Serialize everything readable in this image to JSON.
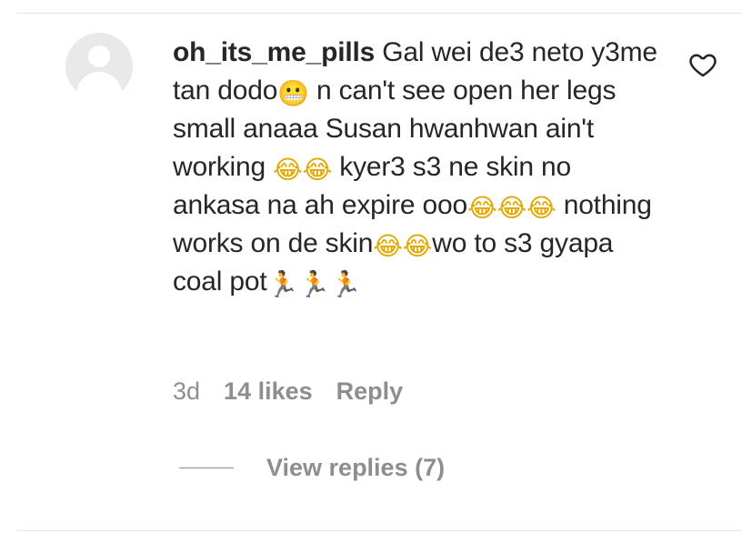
{
  "comment": {
    "username": "oh_its_me_pills",
    "segments": [
      {
        "type": "text",
        "value": "Gal wei de3 neto y3me tan dodo"
      },
      {
        "type": "emoji",
        "icon": "grimacing-face-icon",
        "glyph": "😬"
      },
      {
        "type": "text",
        "value": " n can't see open her legs small anaaa Susan hwanhwan ain't working "
      },
      {
        "type": "emoji",
        "icon": "laughing-tears-icon",
        "glyph": "😂"
      },
      {
        "type": "emoji",
        "icon": "laughing-tears-icon",
        "glyph": "😂"
      },
      {
        "type": "text",
        "value": " kyer3 s3 ne skin no ankasa na ah expire ooo"
      },
      {
        "type": "emoji",
        "icon": "laughing-tears-icon",
        "glyph": "😂"
      },
      {
        "type": "emoji",
        "icon": "laughing-tears-icon",
        "glyph": "😂"
      },
      {
        "type": "emoji",
        "icon": "laughing-tears-icon",
        "glyph": "😂"
      },
      {
        "type": "text",
        "value": " nothing works on de skin"
      },
      {
        "type": "emoji",
        "icon": "laughing-tears-icon",
        "glyph": "😂"
      },
      {
        "type": "emoji",
        "icon": "laughing-tears-icon",
        "glyph": "😂"
      },
      {
        "type": "text",
        "value": "wo to s3 gyapa coal pot"
      },
      {
        "type": "emoji",
        "icon": "running-man-icon",
        "glyph": "🏃"
      },
      {
        "type": "emoji",
        "icon": "running-man-icon",
        "glyph": "🏃"
      },
      {
        "type": "emoji",
        "icon": "running-man-icon",
        "glyph": "🏃"
      }
    ],
    "time": "3d",
    "likes": "14 likes",
    "reply_label": "Reply",
    "view_replies_label": "View replies (7)",
    "like_icon": "heart-outline-icon"
  },
  "colors": {
    "text": "#262626",
    "muted": "#8e8e8e",
    "avatar_bg": "#e9e9e9",
    "divider": "#e6e6e6"
  }
}
